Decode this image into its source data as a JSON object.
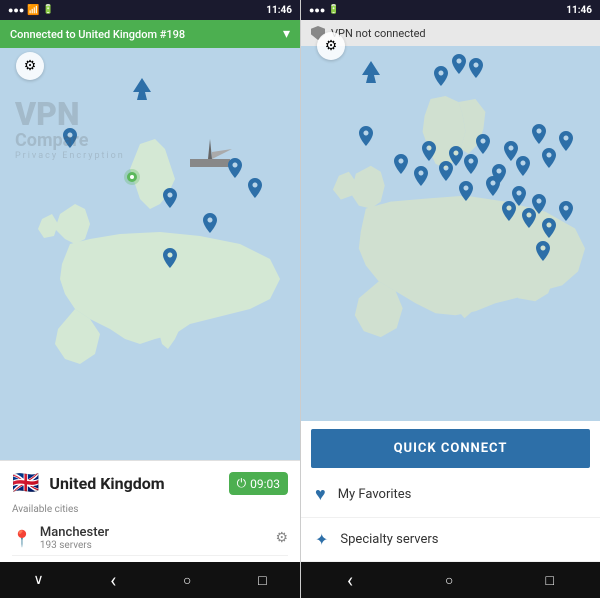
{
  "left": {
    "status_bar": {
      "signal": "●●●",
      "wifi": "WiFi",
      "battery": "■",
      "time": "11:46"
    },
    "connected_bar": {
      "text": "Connected to United Kingdom #198",
      "chevron": "▾"
    },
    "gear_label": "⚙",
    "country": {
      "flag": "🇬🇧",
      "name": "United Kingdom",
      "timer": "09:03",
      "power_icon": "⏻"
    },
    "available_cities_label": "Available cities",
    "city": {
      "name": "Manchester",
      "servers": "193 servers",
      "pin_icon": "📍",
      "settings_icon": "⚙"
    }
  },
  "right": {
    "status_bar": {
      "signal": "●●●",
      "battery": "■",
      "time": "11:46"
    },
    "not_connected_bar": {
      "text": "VPN not connected"
    },
    "gear_label": "⚙",
    "quick_connect_label": "QUICK CONNECT",
    "menu_items": [
      {
        "icon": "♥",
        "label": "My Favorites"
      },
      {
        "icon": "★",
        "label": "Specialty servers"
      }
    ]
  },
  "nav": {
    "back": "‹",
    "home": "○",
    "recent": "□",
    "arrow": "∨"
  }
}
